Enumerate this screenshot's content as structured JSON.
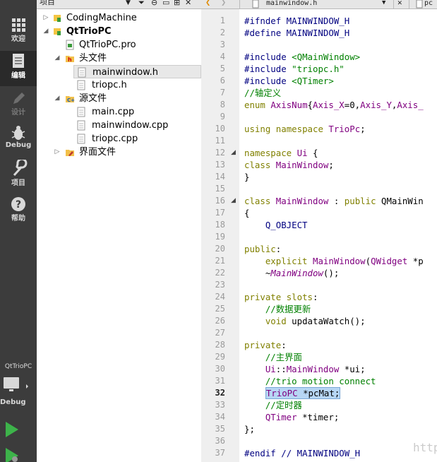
{
  "sidebar": {
    "modes": [
      {
        "label": "欢迎",
        "icon": "grid-icon"
      },
      {
        "label": "编辑",
        "icon": "document-icon"
      },
      {
        "label": "设计",
        "icon": "pencil-icon"
      },
      {
        "label": "Debug",
        "icon": "bug-icon"
      },
      {
        "label": "项目",
        "icon": "wrench-icon"
      },
      {
        "label": "帮助",
        "icon": "help-icon"
      }
    ],
    "kit_project": "QtTrioPC",
    "kit_label": "Debug"
  },
  "project_pane": {
    "title": "项目",
    "tree": [
      {
        "label": "CodingMachine",
        "bold": false
      },
      {
        "label": "QtTrioPC",
        "bold": true
      },
      {
        "label": "QtTrioPC.pro"
      },
      {
        "label": "头文件"
      },
      {
        "label": "mainwindow.h",
        "selected": true
      },
      {
        "label": "triopc.h"
      },
      {
        "label": "源文件"
      },
      {
        "label": "main.cpp"
      },
      {
        "label": "mainwindow.cpp"
      },
      {
        "label": "triopc.cpp"
      },
      {
        "label": "界面文件"
      }
    ]
  },
  "editor": {
    "open_file": "mainwindow.h",
    "next_tab": "pc",
    "current_line": 32,
    "line_numbers": [
      "1",
      "2",
      "3",
      "4",
      "5",
      "6",
      "7",
      "8",
      "9",
      "10",
      "11",
      "12",
      "13",
      "14",
      "15",
      "16",
      "17",
      "18",
      "19",
      "20",
      "21",
      "22",
      "23",
      "24",
      "25",
      "26",
      "27",
      "28",
      "29",
      "30",
      "31",
      "32",
      "33",
      "34",
      "35",
      "36",
      "37"
    ],
    "lines": [
      "#ifndef MAINWINDOW_H",
      "#define MAINWINDOW_H",
      "",
      "#include <QMainWindow>",
      "#include \"triopc.h\"",
      "#include <QTimer>",
      "//轴定义",
      "enum AxisNum{Axis_X=0,Axis_Y,Axis_",
      "",
      "using namespace TrioPc;",
      "",
      "namespace Ui {",
      "class MainWindow;",
      "}",
      "",
      "class MainWindow : public QMainWin",
      "{",
      "    Q_OBJECT",
      "",
      "public:",
      "    explicit MainWindow(QWidget *p",
      "    ~MainWindow();",
      "",
      "private slots:",
      "    //数据更新",
      "    void updataWatch();",
      "",
      "private:",
      "    //主界面",
      "    Ui::MainWindow *ui;",
      "    //trio motion connect",
      "    TrioPC *pcMat;",
      "    //定时器",
      "    QTimer *timer;",
      "};",
      "",
      "#endif // MAINWINDOW_H"
    ]
  },
  "watermark": "http://blog.csdn.net/guimotion",
  "colors": {
    "sidebar_bg": "#3c3c3c",
    "gutter_bg": "#efefef",
    "keyword": "#808000",
    "type": "#800080",
    "preprocessor": "#000080",
    "string_comment": "#008000",
    "selection": "#b7d6f4"
  }
}
